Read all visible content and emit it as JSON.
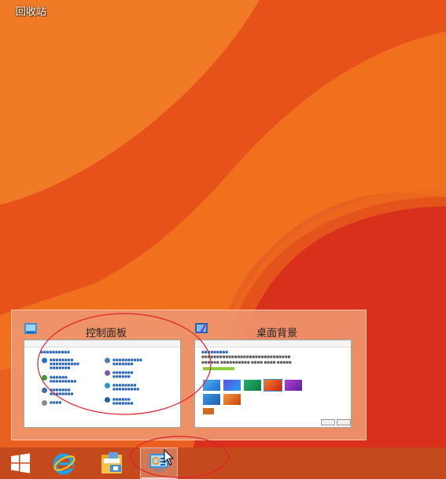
{
  "desktop": {
    "recycle_bin_label": "回收站"
  },
  "thumbnails": [
    {
      "title": "控制面板",
      "icon": "control-panel-icon"
    },
    {
      "title": "桌面背景",
      "icon": "desktop-background-icon"
    }
  ],
  "taskbar": {
    "items": [
      {
        "icon": "windows-start-icon"
      },
      {
        "icon": "internet-explorer-icon"
      },
      {
        "icon": "file-explorer-icon"
      },
      {
        "icon": "control-panel-icon",
        "active": true
      }
    ]
  },
  "colors": {
    "wallpaper": "#e85a1c",
    "panel": "#ee966e",
    "taskbar": "#c44a1e",
    "annotation": "#e0202a"
  }
}
